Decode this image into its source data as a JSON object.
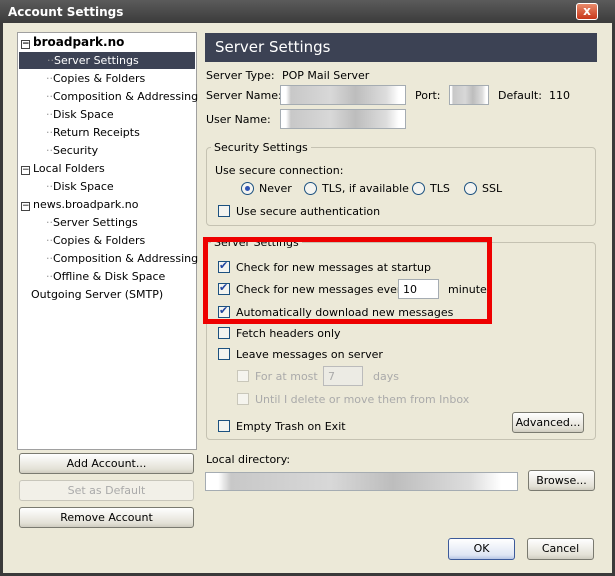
{
  "window": {
    "title": "Account Settings",
    "close": "x"
  },
  "tree": [
    {
      "label": "broadpark.no",
      "level": 0,
      "bold": true,
      "expander": "−"
    },
    {
      "label": "Server Settings",
      "level": 1,
      "selected": true
    },
    {
      "label": "Copies & Folders",
      "level": 1
    },
    {
      "label": "Composition & Addressing",
      "level": 1
    },
    {
      "label": "Disk Space",
      "level": 1
    },
    {
      "label": "Return Receipts",
      "level": 1
    },
    {
      "label": "Security",
      "level": 1
    },
    {
      "label": "Local Folders",
      "level": 0,
      "expander": "−"
    },
    {
      "label": "Disk Space",
      "level": 1
    },
    {
      "label": "news.broadpark.no",
      "level": 0,
      "expander": "−"
    },
    {
      "label": "Server Settings",
      "level": 1
    },
    {
      "label": "Copies & Folders",
      "level": 1
    },
    {
      "label": "Composition & Addressing",
      "level": 1
    },
    {
      "label": "Offline & Disk Space",
      "level": 1
    },
    {
      "label": "Outgoing Server (SMTP)",
      "level": 0
    }
  ],
  "left_buttons": {
    "add": "Add Account...",
    "set_default": "Set as Default",
    "remove": "Remove Account"
  },
  "panel": {
    "header": "Server Settings",
    "server_type_label": "Server Type:",
    "server_type": "POP Mail Server",
    "server_name_label": "Server Name:",
    "port_label": "Port:",
    "default_label": "Default:",
    "default_port": "110",
    "user_name_label": "User Name:",
    "security": {
      "legend": "Security Settings",
      "use_secure": "Use secure connection:",
      "options": [
        "Never",
        "TLS, if available",
        "TLS",
        "SSL"
      ],
      "selected": "Never",
      "secure_auth": "Use secure authentication",
      "secure_auth_checked": false
    },
    "server": {
      "legend": "Server Settings",
      "check_startup": "Check for new messages at startup",
      "check_every": "Check for new messages every",
      "check_every_value": "10",
      "minutes": "minutes",
      "auto_download": "Automatically download new messages",
      "fetch_headers": "Fetch headers only",
      "leave_on_server": "Leave messages on server",
      "for_at_most": "For at most",
      "days_value": "7",
      "days": "days",
      "until_delete": "Until I delete or move them from Inbox",
      "empty_trash": "Empty Trash on Exit",
      "advanced": "Advanced..."
    },
    "local_dir_label": "Local directory:",
    "browse": "Browse..."
  },
  "footer": {
    "ok": "OK",
    "cancel": "Cancel"
  },
  "colors": {
    "header": "#3c4254",
    "highlight": "#ee0000"
  }
}
